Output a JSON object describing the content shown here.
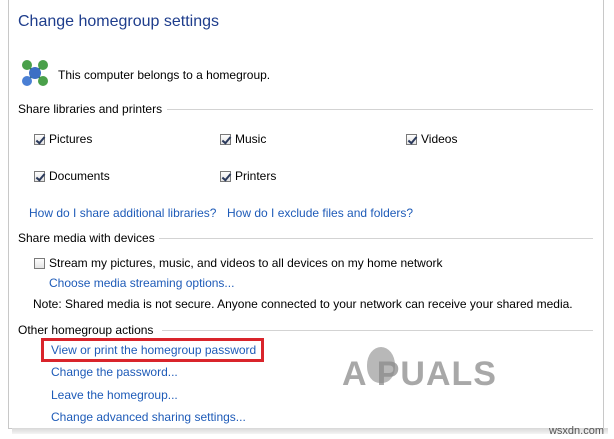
{
  "window": {
    "title": "Change homegroup settings"
  },
  "status": {
    "text": "This computer belongs to a homegroup."
  },
  "share_libraries": {
    "heading": "Share libraries and printers",
    "items": [
      {
        "label": "Pictures",
        "checked": true
      },
      {
        "label": "Music",
        "checked": true
      },
      {
        "label": "Videos",
        "checked": true
      },
      {
        "label": "Documents",
        "checked": true
      },
      {
        "label": "Printers",
        "checked": true
      }
    ],
    "links": [
      "How do I share additional libraries?",
      "How do I exclude files and folders?"
    ]
  },
  "share_media": {
    "heading": "Share media with devices",
    "stream_label": "Stream my pictures, music, and videos to all devices on my home network",
    "stream_checked": false,
    "options_link": "Choose media streaming options...",
    "note": "Note: Shared media is not secure. Anyone connected to your network can receive your shared media."
  },
  "other_actions": {
    "heading": "Other homegroup actions",
    "links": [
      "View or print the homegroup password",
      "Change the password...",
      "Leave the homegroup...",
      "Change advanced sharing settings..."
    ]
  },
  "watermark": {
    "text": "A  PUALS",
    "site": "wsxdn.com"
  },
  "colors": {
    "title": "#1e3d8c",
    "link": "#1e5bb8",
    "highlight": "#d9242b"
  },
  "icons": {
    "homegroup": "homegroup-network-icon"
  }
}
